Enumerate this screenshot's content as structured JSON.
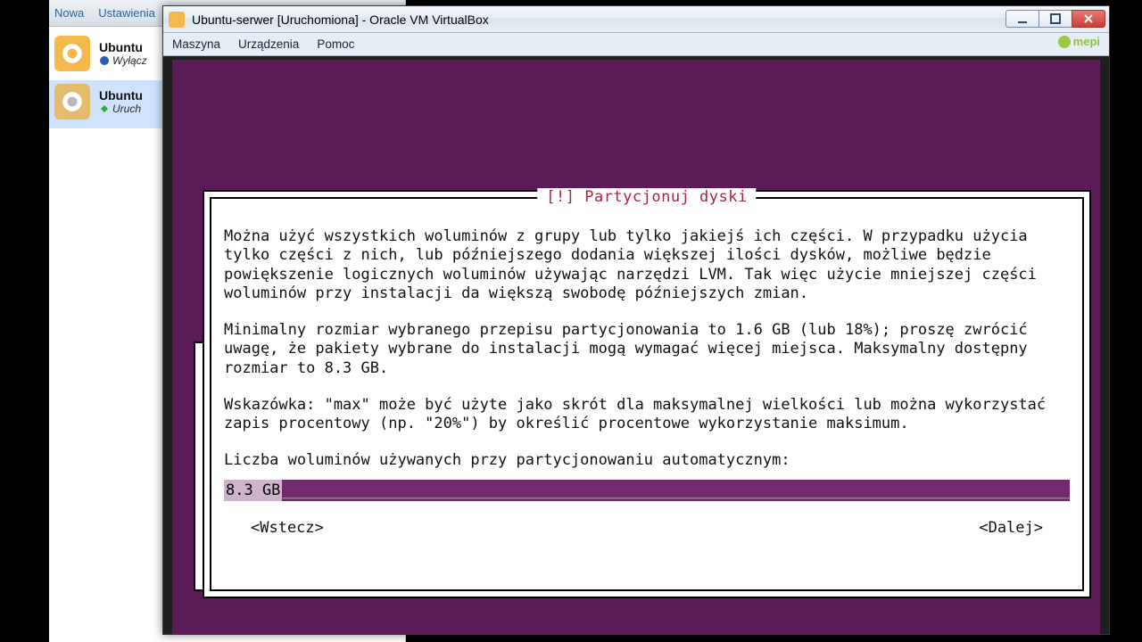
{
  "manager": {
    "toolbar": {
      "nowa": "Nowa",
      "ustawienia": "Ustawienia"
    },
    "vms": [
      {
        "name": "Ubuntu",
        "state": "Wyłącz",
        "state_icon": "power-icon"
      },
      {
        "name": "Ubuntu",
        "state": "Uruch",
        "state_icon": "run-icon"
      }
    ]
  },
  "vmwin": {
    "title": "Ubuntu-serwer [Uruchomiona] - Oracle VM VirtualBox",
    "menus": {
      "maszyna": "Maszyna",
      "urzadzenia": "Urządzenia",
      "pomoc": "Pomoc"
    },
    "watermark": "mepi"
  },
  "installer": {
    "title": "[!] Partycjonuj dyski",
    "para1": "Można użyć wszystkich woluminów z grupy lub tylko jakiejś ich części. W przypadku użycia tylko części z nich, lub późniejszego dodania większej ilości dysków, możliwe będzie powiększenie logicznych woluminów używając narzędzi LVM. Tak więc użycie mniejszej części woluminów przy instalacji da większą swobodę późniejszych zmian.",
    "para2": "Minimalny rozmiar wybranego przepisu partycjonowania to 1.6 GB (lub 18%); proszę zwrócić uwagę, że pakiety wybrane do instalacji mogą wymagać więcej miejsca. Maksymalny dostępny rozmiar to 8.3 GB.",
    "para3": "Wskazówka: \"max\" może być użyte jako skrót dla maksymalnej wielkości lub można wykorzystać zapis procentowy (np. \"20%\") by określić procentowe wykorzystanie maksimum.",
    "prompt": "Liczba woluminów używanych przy partycjonowaniu automatycznym:",
    "value": "8.3 GB",
    "back": "<Wstecz>",
    "next": "<Dalej>"
  }
}
